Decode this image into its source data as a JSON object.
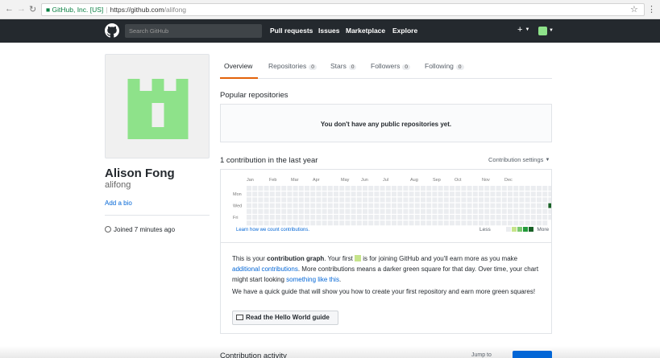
{
  "browser": {
    "secure_label": "GitHub, Inc. [US]",
    "url_host": "https://github.com",
    "url_path": "/alifong"
  },
  "header": {
    "search_placeholder": "Search GitHub",
    "nav": [
      "Pull requests",
      "Issues",
      "Marketplace",
      "Explore"
    ],
    "plus": "+"
  },
  "profile": {
    "name": "Alison Fong",
    "login": "alifong",
    "add_bio": "Add a bio",
    "joined": "Joined 7 minutes ago"
  },
  "tabs": [
    {
      "label": "Overview",
      "count": ""
    },
    {
      "label": "Repositories",
      "count": "0"
    },
    {
      "label": "Stars",
      "count": "0"
    },
    {
      "label": "Followers",
      "count": "0"
    },
    {
      "label": "Following",
      "count": "0"
    }
  ],
  "popular": {
    "heading": "Popular repositories",
    "empty": "You don't have any public repositories yet."
  },
  "contributions": {
    "heading": "1 contribution in the last year",
    "settings": "Contribution settings",
    "months": [
      "Jan",
      "Feb",
      "Mar",
      "Apr",
      "May",
      "Jun",
      "Jul",
      "Aug",
      "Sep",
      "Oct",
      "Nov",
      "Dec"
    ],
    "days": [
      "Mon",
      "Wed",
      "Fri"
    ],
    "learn": "Learn how we count contributions.",
    "legend_less": "Less",
    "legend_more": "More",
    "colors": [
      "#ebedf0",
      "#c6e48b",
      "#7bc96f",
      "#239a3b",
      "#196127"
    ]
  },
  "intro": {
    "p1a": "This is your ",
    "p1b": "contribution graph",
    "p1c": ". Your first ",
    "p1d": " is for joining GitHub and you'll earn more as you make ",
    "p1e": "additional contributions",
    "p1f": ". More contributions means a darker green square for that day. Over time, your chart might start looking ",
    "p1g": "something like this",
    "p1h": ".",
    "p2": "We have a quick guide that will show you how to create your first repository and earn more green squares!",
    "button": "Read the Hello World guide"
  },
  "activity": {
    "heading": "Contribution activity",
    "jump": "Jump to"
  }
}
